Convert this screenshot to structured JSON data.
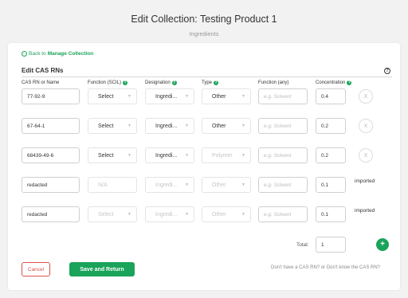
{
  "page": {
    "title": "Edit Collection: Testing Product 1",
    "subtitle": "Ingredients"
  },
  "back_link": {
    "prefix": "Back to",
    "label": "Manage Collection"
  },
  "section": {
    "title": "Edit CAS RNs",
    "help_icon": "question-circle-icon"
  },
  "columns": {
    "cas": "CAS RN or Name",
    "function_scil": "Function (SCIL)",
    "designation": "Designation",
    "type": "Type",
    "function_any": "Function (any)",
    "concentration": "Concentration"
  },
  "rows": [
    {
      "cas": "77-92-9",
      "function_scil": "Select",
      "designation": "Ingredi...",
      "type": "Other",
      "function_any": "e.g. Solvent",
      "concentration": "0.4",
      "remove": "X",
      "note": ""
    },
    {
      "cas": "67-64-1",
      "function_scil": "Select",
      "designation": "Ingredi...",
      "type": "Other",
      "function_any": "e.g. Solvent",
      "concentration": "0.2",
      "remove": "X",
      "note": ""
    },
    {
      "cas": "68439-49-6",
      "function_scil": "Select",
      "designation": "Ingredi...",
      "type": "Polymer",
      "function_any": "e.g. Solvent",
      "concentration": "0.2",
      "remove": "X",
      "note": ""
    },
    {
      "cas": "redacted",
      "function_scil": "N/A",
      "designation": "Ingredi...",
      "type": "Other",
      "function_any": "e.g. Solvent",
      "concentration": "0.1",
      "remove": "",
      "note": "imported"
    },
    {
      "cas": "redacted",
      "function_scil": "Select",
      "designation": "Ingredi...",
      "type": "Other",
      "function_any": "e.g. Solvent",
      "concentration": "0.1",
      "remove": "",
      "note": "imported"
    }
  ],
  "total": {
    "label": "Total:",
    "value": "1"
  },
  "add_button": "+",
  "actions": {
    "cancel": "Cancel",
    "save": "Save and Return"
  },
  "cas_help": "Don't have a CAS RN? or Don't know the CAS RN?",
  "colors": {
    "accent": "#1aa35a",
    "danger": "#d9534f"
  }
}
